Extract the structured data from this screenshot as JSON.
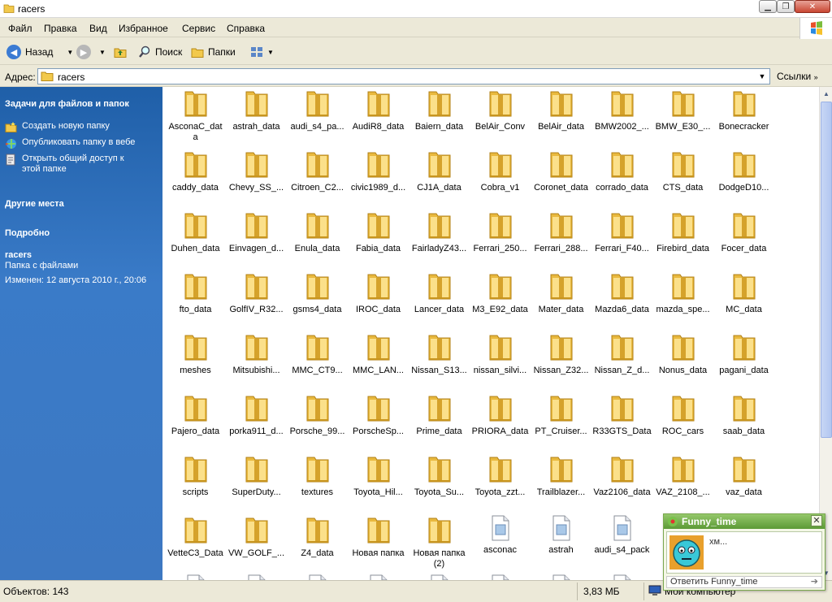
{
  "window": {
    "title": "racers"
  },
  "menu": {
    "items": [
      "Файл",
      "Правка",
      "Вид",
      "Избранное",
      "Сервис",
      "Справка"
    ]
  },
  "toolbar": {
    "back": "Назад",
    "search": "Поиск",
    "folders": "Папки"
  },
  "address": {
    "label": "Адрес:",
    "value": "racers",
    "links": "Ссылки"
  },
  "sidebar": {
    "tasks_title": "Задачи для файлов и папок",
    "task1": "Создать новую папку",
    "task2": "Опубликовать папку в вебе",
    "task3a": "Открыть общий доступ к",
    "task3b": "этой папке",
    "other_places": "Другие места",
    "details_title": "Подробно",
    "details_name": "racers",
    "details_type": "Папка с файлами",
    "details_modified": "Изменен: 12 августа 2010 г., 20:06"
  },
  "files": [
    {
      "name": [
        "AsconaC_dat",
        "a"
      ],
      "type": "folder"
    },
    {
      "name": [
        "astrah_data"
      ],
      "type": "folder"
    },
    {
      "name": [
        "audi_s4_pa..."
      ],
      "type": "folder"
    },
    {
      "name": [
        "AudiR8_data"
      ],
      "type": "folder"
    },
    {
      "name": [
        "Baiern_data"
      ],
      "type": "folder"
    },
    {
      "name": [
        "BelAir_Conv"
      ],
      "type": "folder"
    },
    {
      "name": [
        "BelAir_data"
      ],
      "type": "folder"
    },
    {
      "name": [
        "BMW2002_..."
      ],
      "type": "folder"
    },
    {
      "name": [
        "BMW_E30_..."
      ],
      "type": "folder"
    },
    {
      "name": [
        "Bonecracker"
      ],
      "type": "folder"
    },
    {
      "name": [
        "caddy_data"
      ],
      "type": "folder"
    },
    {
      "name": [
        "Chevy_SS_..."
      ],
      "type": "folder"
    },
    {
      "name": [
        "Citroen_C2..."
      ],
      "type": "folder"
    },
    {
      "name": [
        "civic1989_d..."
      ],
      "type": "folder"
    },
    {
      "name": [
        "CJ1A_data"
      ],
      "type": "folder"
    },
    {
      "name": [
        "Cobra_v1"
      ],
      "type": "folder"
    },
    {
      "name": [
        "Coronet_data"
      ],
      "type": "folder"
    },
    {
      "name": [
        "corrado_data"
      ],
      "type": "folder"
    },
    {
      "name": [
        "CTS_data"
      ],
      "type": "folder"
    },
    {
      "name": [
        "DodgeD10..."
      ],
      "type": "folder"
    },
    {
      "name": [
        "Duhen_data"
      ],
      "type": "folder"
    },
    {
      "name": [
        "Einvagen_d..."
      ],
      "type": "folder"
    },
    {
      "name": [
        "Enula_data"
      ],
      "type": "folder"
    },
    {
      "name": [
        "Fabia_data"
      ],
      "type": "folder"
    },
    {
      "name": [
        "FairladyZ43..."
      ],
      "type": "folder"
    },
    {
      "name": [
        "Ferrari_250..."
      ],
      "type": "folder"
    },
    {
      "name": [
        "Ferrari_288..."
      ],
      "type": "folder"
    },
    {
      "name": [
        "Ferrari_F40..."
      ],
      "type": "folder"
    },
    {
      "name": [
        "Firebird_data"
      ],
      "type": "folder"
    },
    {
      "name": [
        "Focer_data"
      ],
      "type": "folder"
    },
    {
      "name": [
        "fto_data"
      ],
      "type": "folder"
    },
    {
      "name": [
        "GolfIV_R32..."
      ],
      "type": "folder"
    },
    {
      "name": [
        "gsms4_data"
      ],
      "type": "folder"
    },
    {
      "name": [
        "IROC_data"
      ],
      "type": "folder"
    },
    {
      "name": [
        "Lancer_data"
      ],
      "type": "folder"
    },
    {
      "name": [
        "M3_E92_data"
      ],
      "type": "folder"
    },
    {
      "name": [
        "Mater_data"
      ],
      "type": "folder"
    },
    {
      "name": [
        "Mazda6_data"
      ],
      "type": "folder"
    },
    {
      "name": [
        "mazda_spe..."
      ],
      "type": "folder"
    },
    {
      "name": [
        "MC_data"
      ],
      "type": "folder"
    },
    {
      "name": [
        "meshes"
      ],
      "type": "folder"
    },
    {
      "name": [
        "Mitsubishi..."
      ],
      "type": "folder"
    },
    {
      "name": [
        "MMC_CT9..."
      ],
      "type": "folder"
    },
    {
      "name": [
        "MMC_LAN..."
      ],
      "type": "folder"
    },
    {
      "name": [
        "Nissan_S13..."
      ],
      "type": "folder"
    },
    {
      "name": [
        "nissan_silvi..."
      ],
      "type": "folder"
    },
    {
      "name": [
        "Nissan_Z32..."
      ],
      "type": "folder"
    },
    {
      "name": [
        "Nissan_Z_d..."
      ],
      "type": "folder"
    },
    {
      "name": [
        "Nonus_data"
      ],
      "type": "folder"
    },
    {
      "name": [
        "pagani_data"
      ],
      "type": "folder"
    },
    {
      "name": [
        "Pajero_data"
      ],
      "type": "folder"
    },
    {
      "name": [
        "porka911_d..."
      ],
      "type": "folder"
    },
    {
      "name": [
        "Porsche_99..."
      ],
      "type": "folder"
    },
    {
      "name": [
        "PorscheSp..."
      ],
      "type": "folder"
    },
    {
      "name": [
        "Prime_data"
      ],
      "type": "folder"
    },
    {
      "name": [
        "PRIORA_data"
      ],
      "type": "folder"
    },
    {
      "name": [
        "PT_Cruiser..."
      ],
      "type": "folder"
    },
    {
      "name": [
        "R33GTS_Data"
      ],
      "type": "folder"
    },
    {
      "name": [
        "ROC_cars"
      ],
      "type": "folder"
    },
    {
      "name": [
        "saab_data"
      ],
      "type": "folder"
    },
    {
      "name": [
        "scripts"
      ],
      "type": "folder"
    },
    {
      "name": [
        "SuperDuty..."
      ],
      "type": "folder"
    },
    {
      "name": [
        "textures"
      ],
      "type": "folder"
    },
    {
      "name": [
        "Toyota_Hil..."
      ],
      "type": "folder"
    },
    {
      "name": [
        "Toyota_Su..."
      ],
      "type": "folder"
    },
    {
      "name": [
        "Toyota_zzt..."
      ],
      "type": "folder"
    },
    {
      "name": [
        "Trailblazer..."
      ],
      "type": "folder"
    },
    {
      "name": [
        "Vaz2106_data"
      ],
      "type": "folder"
    },
    {
      "name": [
        "VAZ_2108_..."
      ],
      "type": "folder"
    },
    {
      "name": [
        "vaz_data"
      ],
      "type": "folder"
    },
    {
      "name": [
        "VetteC3_Data"
      ],
      "type": "folder"
    },
    {
      "name": [
        "VW_GOLF_..."
      ],
      "type": "folder"
    },
    {
      "name": [
        "Z4_data"
      ],
      "type": "folder"
    },
    {
      "name": [
        "Новая папка"
      ],
      "type": "folder"
    },
    {
      "name": [
        "Новая папка",
        "(2)"
      ],
      "type": "folder"
    },
    {
      "name": [
        "asconac"
      ],
      "type": "file"
    },
    {
      "name": [
        "astrah"
      ],
      "type": "file"
    },
    {
      "name": [
        "audi_s4_pack"
      ],
      "type": "file"
    }
  ],
  "status": {
    "objects": "Объектов: 143",
    "size": "3,83 МБ",
    "location": "Мой компьютер"
  },
  "popup": {
    "title": "Funny_time",
    "message": "хм...",
    "reply": "Ответить Funny_time"
  }
}
